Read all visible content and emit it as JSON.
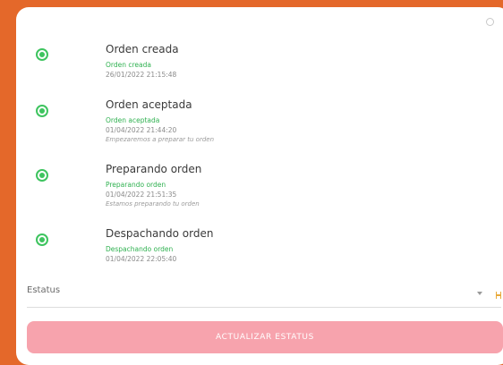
{
  "timeline": [
    {
      "title": "Orden creada",
      "status": "Orden creada",
      "datetime": "26/01/2022 21:15:48",
      "note": ""
    },
    {
      "title": "Orden aceptada",
      "status": "Orden aceptada",
      "datetime": "01/04/2022 21:44:20",
      "note": "Empezaremos a preparar tu orden"
    },
    {
      "title": "Preparando orden",
      "status": "Preparando orden",
      "datetime": "01/04/2022 21:51:35",
      "note": "Estamos preparando tu orden"
    },
    {
      "title": "Despachando orden",
      "status": "Despachando orden",
      "datetime": "01/04/2022 22:05:40",
      "note": ""
    }
  ],
  "status_field": {
    "label": "Estatus"
  },
  "update_button": {
    "label": "ACTUALIZAR ESTATUS"
  },
  "colors": {
    "accent_green": "#3ec45f",
    "background_orange": "#e4682a",
    "button_pink": "#f7a3ad"
  },
  "icons": [
    "radio-checked-icon",
    "dropdown-arrow-icon",
    "settings-icon"
  ]
}
